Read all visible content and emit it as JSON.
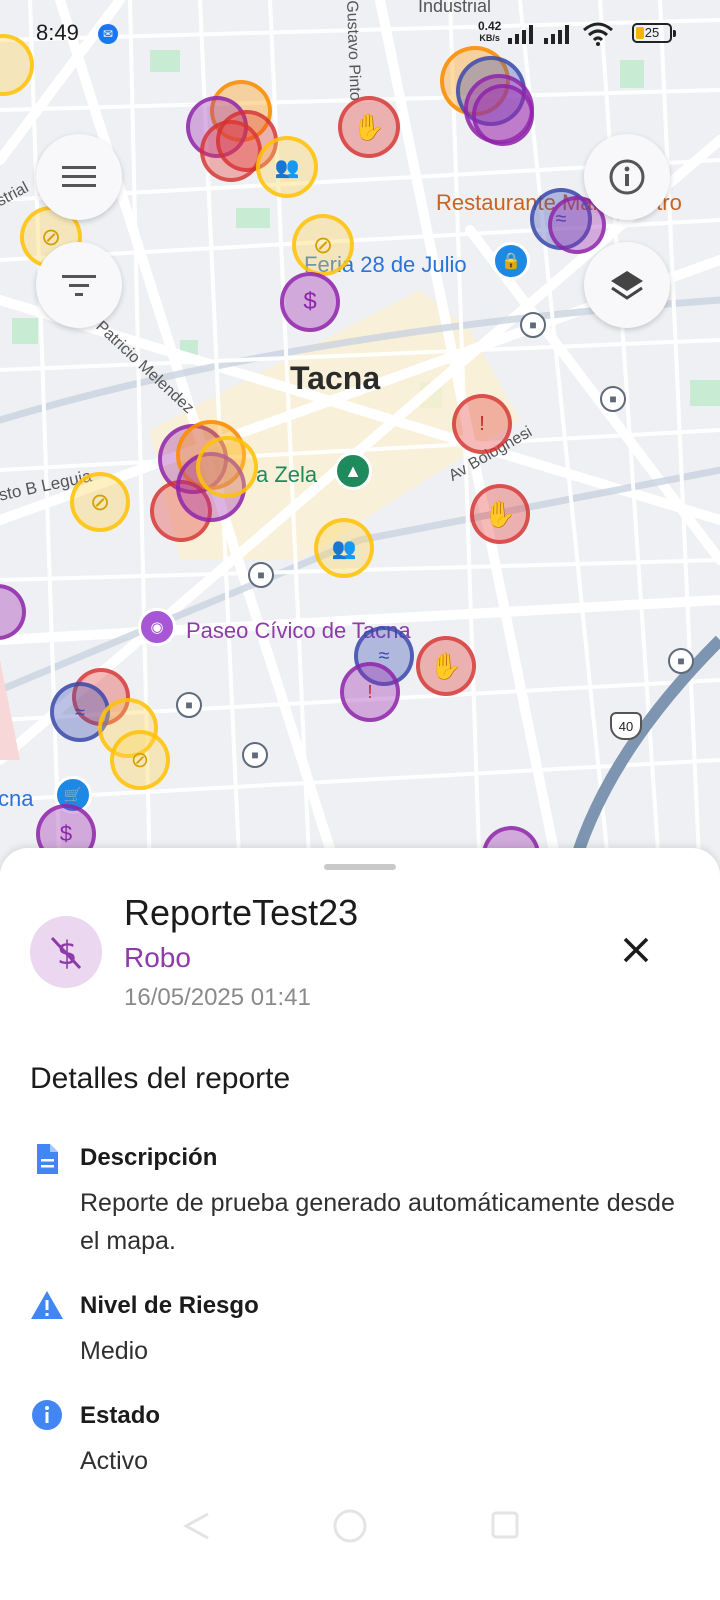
{
  "status_bar": {
    "time": "8:49",
    "speed_value": "0.42",
    "speed_unit": "KB/s",
    "battery": "25"
  },
  "map": {
    "labels": {
      "industrial": "Industrial",
      "gustavo_pinto": "Gustavo Pinto",
      "restaurante": "Restaurante Mar Adentro",
      "feria": "Feria 28 de Julio",
      "patricio": "Patricio Melendez",
      "tacna": "Tacna",
      "zela": "a Zela",
      "bolognesi": "Av Bolognesi",
      "leguia": "sto B Leguia",
      "paseo": "Paseo Cívico de Tacna",
      "cna": "cna",
      "highway": "40",
      "istrial": "strial"
    }
  },
  "sheet": {
    "title": "ReporteTest23",
    "category": "Robo",
    "datetime": "16/05/2025 01:41",
    "section_title": "Detalles del reporte",
    "rows": [
      {
        "label": "Descripción",
        "value": "Reporte de prueba generado automáticamente desde el mapa.",
        "icon": "document-icon"
      },
      {
        "label": "Nivel de Riesgo",
        "value": "Medio",
        "icon": "warning-icon"
      },
      {
        "label": "Estado",
        "value": "Activo",
        "icon": "info-icon"
      }
    ]
  },
  "colors": {
    "accent_purple": "#8e3aa8",
    "icon_blue": "#4285f4",
    "map_bg": "#eef0f3"
  }
}
